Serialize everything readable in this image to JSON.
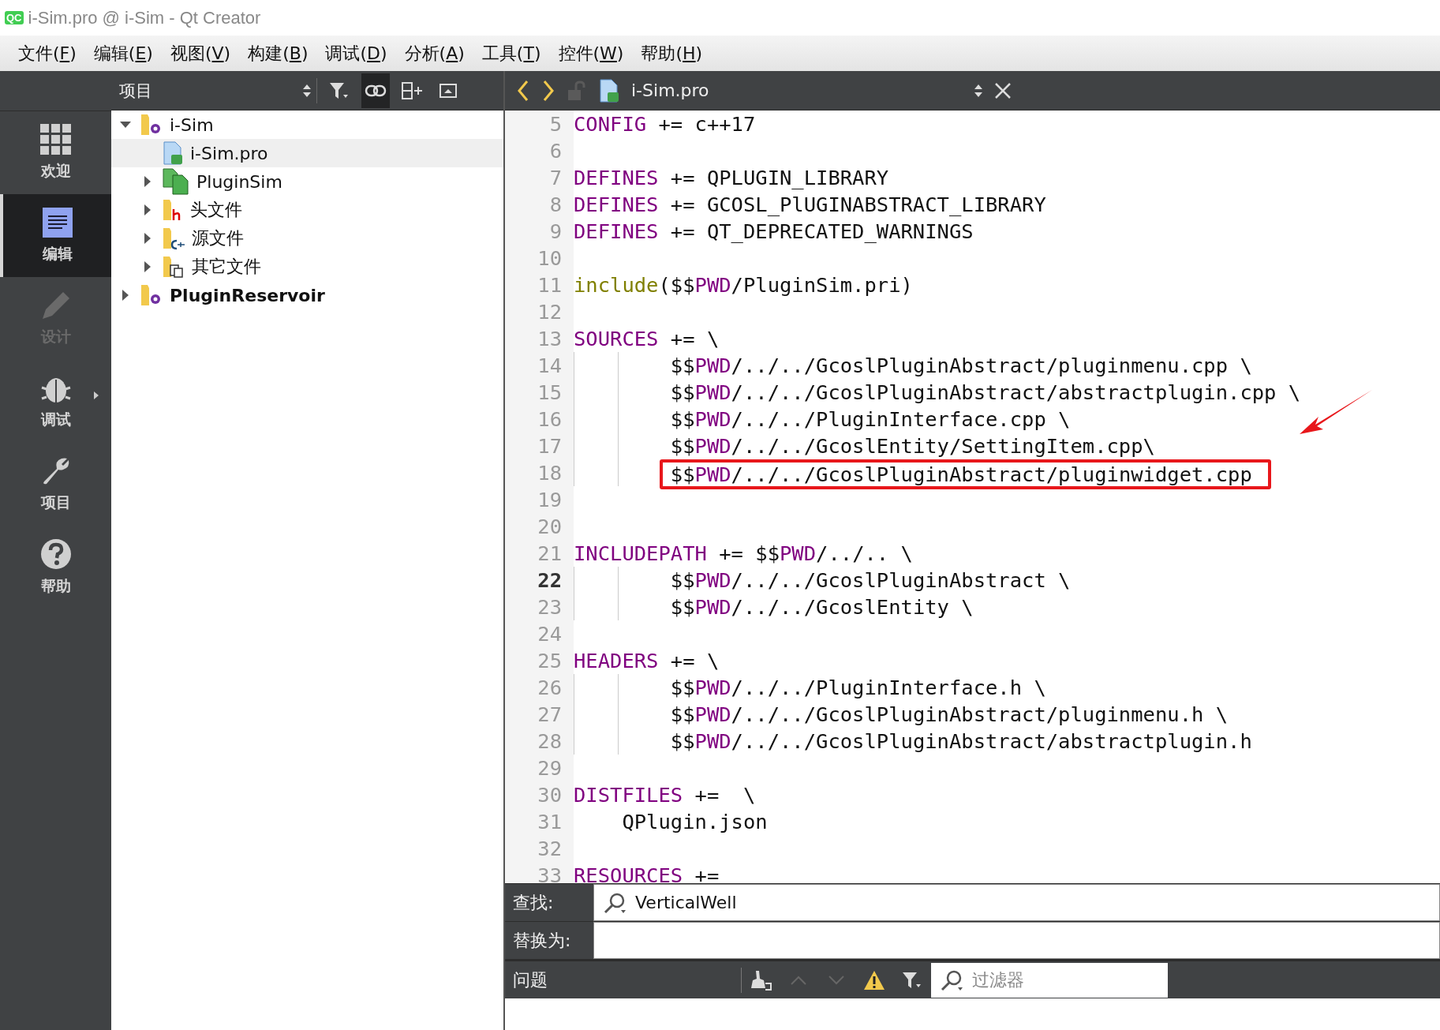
{
  "window": {
    "app_icon": "QC",
    "title": "i-Sim.pro @ i-Sim - Qt Creator"
  },
  "menu": [
    "文件(F)",
    "编辑(E)",
    "视图(V)",
    "构建(B)",
    "调试(D)",
    "分析(A)",
    "工具(T)",
    "控件(W)",
    "帮助(H)"
  ],
  "modes": [
    {
      "kind": "welcome",
      "label": "欢迎",
      "selected": false,
      "disabled": false,
      "has_submenu": false
    },
    {
      "kind": "edit",
      "label": "编辑",
      "selected": true,
      "disabled": false,
      "has_submenu": false
    },
    {
      "kind": "design",
      "label": "设计",
      "selected": false,
      "disabled": true,
      "has_submenu": false
    },
    {
      "kind": "debug",
      "label": "调试",
      "selected": false,
      "disabled": false,
      "has_submenu": true
    },
    {
      "kind": "projects",
      "label": "项目",
      "selected": false,
      "disabled": false,
      "has_submenu": false
    },
    {
      "kind": "help",
      "label": "帮助",
      "selected": false,
      "disabled": false,
      "has_submenu": false
    }
  ],
  "project_pane": {
    "view": "项目",
    "tools": [
      {
        "kind": "filter",
        "on": false
      },
      {
        "kind": "link",
        "on": true
      },
      {
        "kind": "split",
        "on": false
      },
      {
        "kind": "maximize",
        "on": false
      }
    ],
    "tree": [
      {
        "label": "i-Sim",
        "kind": "project",
        "bold": false,
        "selected": false,
        "expanded": true,
        "children": [
          {
            "label": "i-Sim.pro",
            "kind": "pro-file",
            "bold": false,
            "selected": true
          },
          {
            "label": "PluginSim",
            "kind": "subproject",
            "bold": false,
            "selected": false,
            "expanded": false
          },
          {
            "label": "头文件",
            "kind": "headers",
            "bold": false,
            "selected": false,
            "expanded": false
          },
          {
            "label": "源文件",
            "kind": "sources",
            "bold": false,
            "selected": false,
            "expanded": false
          },
          {
            "label": "其它文件",
            "kind": "other",
            "bold": false,
            "selected": false,
            "expanded": false
          }
        ]
      },
      {
        "label": "PluginReservoir",
        "kind": "project",
        "bold": true,
        "selected": false,
        "expanded": false
      }
    ]
  },
  "editor": {
    "file": "i-Sim.pro",
    "lines": [
      {
        "number": "5",
        "current": false,
        "guides": false,
        "marked": false,
        "segments": [
          {
            "kind": "keyword",
            "text": "CONFIG"
          },
          {
            "kind": "plain",
            "text": " += c++17"
          }
        ]
      },
      {
        "number": "6",
        "current": false,
        "guides": false,
        "marked": false
      },
      {
        "number": "7",
        "current": false,
        "guides": false,
        "marked": false,
        "segments": [
          {
            "kind": "keyword",
            "text": "DEFINES"
          },
          {
            "kind": "plain",
            "text": " += QPLUGIN_LIBRARY"
          }
        ]
      },
      {
        "number": "8",
        "current": false,
        "guides": false,
        "marked": false,
        "segments": [
          {
            "kind": "keyword",
            "text": "DEFINES"
          },
          {
            "kind": "plain",
            "text": " += GCOSL_PlUGINABSTRACT_LIBRARY"
          }
        ]
      },
      {
        "number": "9",
        "current": false,
        "guides": false,
        "marked": false,
        "segments": [
          {
            "kind": "keyword",
            "text": "DEFINES"
          },
          {
            "kind": "plain",
            "text": " += QT_DEPRECATED_WARNINGS"
          }
        ]
      },
      {
        "number": "10",
        "current": false,
        "guides": false,
        "marked": false
      },
      {
        "number": "11",
        "current": false,
        "guides": false,
        "marked": false,
        "segments": [
          {
            "kind": "function",
            "text": "include"
          },
          {
            "kind": "plain",
            "text": "($$"
          },
          {
            "kind": "keyword",
            "text": "PWD"
          },
          {
            "kind": "plain",
            "text": "/PluginSim.pri)"
          }
        ]
      },
      {
        "number": "12",
        "current": false,
        "guides": false,
        "marked": false
      },
      {
        "number": "13",
        "current": false,
        "guides": false,
        "marked": false,
        "segments": [
          {
            "kind": "keyword",
            "text": "SOURCES"
          },
          {
            "kind": "plain",
            "text": " += \\"
          }
        ]
      },
      {
        "number": "14",
        "current": false,
        "guides": true,
        "marked": false,
        "segments": [
          {
            "kind": "plain",
            "text": "        $$"
          },
          {
            "kind": "keyword",
            "text": "PWD"
          },
          {
            "kind": "plain",
            "text": "/../../GcoslPluginAbstract/pluginmenu.cpp \\"
          }
        ]
      },
      {
        "number": "15",
        "current": false,
        "guides": true,
        "marked": false,
        "segments": [
          {
            "kind": "plain",
            "text": "        $$"
          },
          {
            "kind": "keyword",
            "text": "PWD"
          },
          {
            "kind": "plain",
            "text": "/../../GcoslPluginAbstract/abstractplugin.cpp \\"
          }
        ]
      },
      {
        "number": "16",
        "current": false,
        "guides": true,
        "marked": false,
        "segments": [
          {
            "kind": "plain",
            "text": "        $$"
          },
          {
            "kind": "keyword",
            "text": "PWD"
          },
          {
            "kind": "plain",
            "text": "/../../PluginInterface.cpp \\"
          }
        ]
      },
      {
        "number": "17",
        "current": false,
        "guides": true,
        "marked": false,
        "segments": [
          {
            "kind": "plain",
            "text": "        $$"
          },
          {
            "kind": "keyword",
            "text": "PWD"
          },
          {
            "kind": "plain",
            "text": "/../../GcoslEntity/SettingItem.cpp\\"
          }
        ]
      },
      {
        "number": "18",
        "current": false,
        "guides": true,
        "marked": true,
        "segments": [
          {
            "kind": "plain",
            "text": "        $$"
          },
          {
            "kind": "keyword",
            "text": "PWD"
          },
          {
            "kind": "plain",
            "text": "/../../GcoslPluginAbstract/pluginwidget.cpp"
          }
        ]
      },
      {
        "number": "19",
        "current": false,
        "guides": false,
        "marked": false
      },
      {
        "number": "20",
        "current": false,
        "guides": false,
        "marked": false
      },
      {
        "number": "21",
        "current": false,
        "guides": false,
        "marked": false,
        "segments": [
          {
            "kind": "keyword",
            "text": "INCLUDEPATH"
          },
          {
            "kind": "plain",
            "text": " += $$"
          },
          {
            "kind": "keyword",
            "text": "PWD"
          },
          {
            "kind": "plain",
            "text": "/../.. \\"
          }
        ]
      },
      {
        "number": "22",
        "current": true,
        "guides": true,
        "marked": false,
        "segments": [
          {
            "kind": "plain",
            "text": "        $$"
          },
          {
            "kind": "keyword",
            "text": "PWD"
          },
          {
            "kind": "plain",
            "text": "/../../GcoslPluginAbstract \\"
          }
        ]
      },
      {
        "number": "23",
        "current": false,
        "guides": true,
        "marked": false,
        "segments": [
          {
            "kind": "plain",
            "text": "        $$"
          },
          {
            "kind": "keyword",
            "text": "PWD"
          },
          {
            "kind": "plain",
            "text": "/../../GcoslEntity \\"
          }
        ]
      },
      {
        "number": "24",
        "current": false,
        "guides": false,
        "marked": false
      },
      {
        "number": "25",
        "current": false,
        "guides": false,
        "marked": false,
        "segments": [
          {
            "kind": "keyword",
            "text": "HEADERS"
          },
          {
            "kind": "plain",
            "text": " += \\"
          }
        ]
      },
      {
        "number": "26",
        "current": false,
        "guides": true,
        "marked": false,
        "segments": [
          {
            "kind": "plain",
            "text": "        $$"
          },
          {
            "kind": "keyword",
            "text": "PWD"
          },
          {
            "kind": "plain",
            "text": "/../../PluginInterface.h \\"
          }
        ]
      },
      {
        "number": "27",
        "current": false,
        "guides": true,
        "marked": false,
        "segments": [
          {
            "kind": "plain",
            "text": "        $$"
          },
          {
            "kind": "keyword",
            "text": "PWD"
          },
          {
            "kind": "plain",
            "text": "/../../GcoslPluginAbstract/pluginmenu.h \\"
          }
        ]
      },
      {
        "number": "28",
        "current": false,
        "guides": true,
        "marked": false,
        "segments": [
          {
            "kind": "plain",
            "text": "        $$"
          },
          {
            "kind": "keyword",
            "text": "PWD"
          },
          {
            "kind": "plain",
            "text": "/../../GcoslPluginAbstract/abstractplugin.h"
          }
        ]
      },
      {
        "number": "29",
        "current": false,
        "guides": false,
        "marked": false
      },
      {
        "number": "30",
        "current": false,
        "guides": false,
        "marked": false,
        "segments": [
          {
            "kind": "keyword",
            "text": "DISTFILES"
          },
          {
            "kind": "plain",
            "text": " +=  \\"
          }
        ]
      },
      {
        "number": "31",
        "current": false,
        "guides": false,
        "marked": false,
        "segments": [
          {
            "kind": "plain",
            "text": "    QPlugin.json"
          }
        ]
      },
      {
        "number": "32",
        "current": false,
        "guides": false,
        "marked": false
      },
      {
        "number": "33",
        "current": false,
        "guides": false,
        "marked": false,
        "segments": [
          {
            "kind": "keyword",
            "text": "RESOURCES"
          },
          {
            "kind": "plain",
            "text": " +="
          }
        ]
      }
    ]
  },
  "find": {
    "find_label": "查找:",
    "find_value": "VerticalWell",
    "replace_label": "替换为:"
  },
  "issues": {
    "title": "问题",
    "filter_placeholder": "过滤器"
  }
}
